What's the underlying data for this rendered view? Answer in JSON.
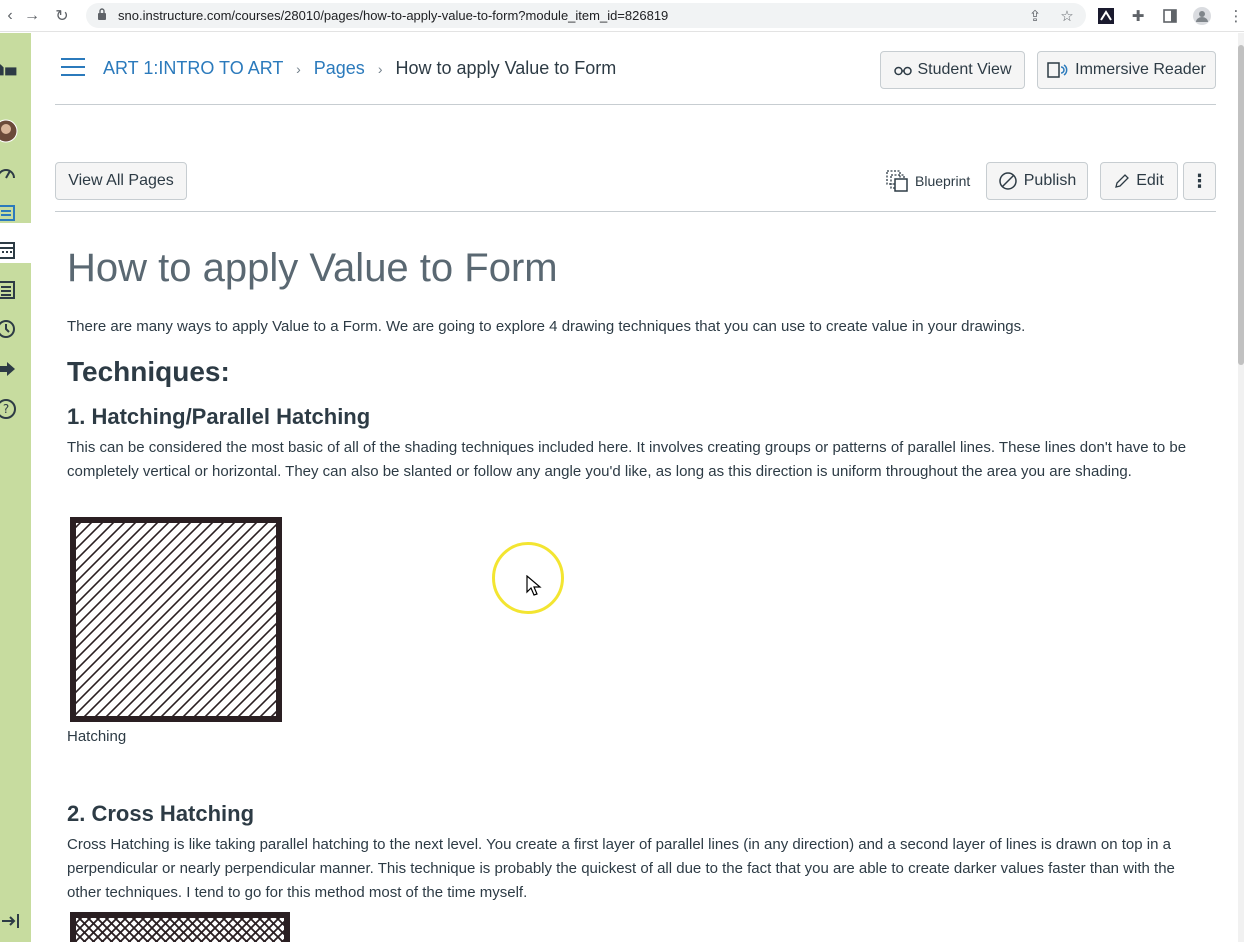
{
  "browser": {
    "url": "sno.instructure.com/courses/28010/pages/how-to-apply-value-to-form?module_item_id=826819"
  },
  "breadcrumb": {
    "course": "ART 1:INTRO TO ART",
    "section": "Pages",
    "current": "How to apply Value to Form"
  },
  "header_buttons": {
    "student_view": "Student View",
    "immersive_reader": "Immersive Reader"
  },
  "toolbar": {
    "view_all_pages": "View All Pages",
    "blueprint": "Blueprint",
    "publish": "Publish",
    "edit": "Edit"
  },
  "content": {
    "title": "How to apply Value to Form",
    "intro": "There are many ways to apply Value to a Form. We are going to explore 4 drawing techniques that you can use to create value in your drawings.",
    "techniques_heading": "Techniques:",
    "sections": [
      {
        "heading": "1. Hatching/Parallel Hatching",
        "body": "This can be considered the most basic of all of the shading techniques included here. It involves creating groups or patterns of parallel lines. These lines don't have to be completely vertical or horizontal. They can also be slanted or follow any angle you'd like, as long as this direction is uniform throughout the area you are shading.",
        "caption": "Hatching"
      },
      {
        "heading": "2. Cross Hatching",
        "body": "Cross Hatching is like taking parallel hatching to the next level. You create a first layer of parallel lines (in any direction) and a second layer of lines is drawn on top in a perpendicular or nearly perpendicular manner. This technique is probably the quickest of all due to the fact that you are able to create darker values faster than with the other techniques. I tend to go for this method most of the time myself."
      }
    ]
  },
  "colors": {
    "link": "#2b7abc",
    "nav_bg": "#c7dc9f",
    "text": "#2d3b45"
  }
}
